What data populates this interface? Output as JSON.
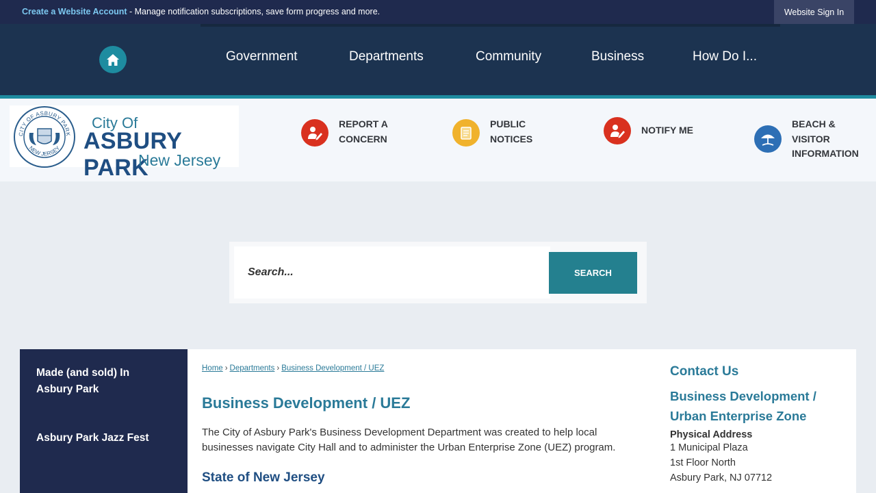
{
  "topbar": {
    "create_account": "Create a Website Account",
    "message": " - Manage notification subscriptions, save form progress and more.",
    "sign_in": "Website Sign In"
  },
  "nav": {
    "home_icon": "home-icon",
    "items": [
      "Government",
      "Departments",
      "Community",
      "Business",
      "How Do I..."
    ]
  },
  "logo": {
    "line1": "City Of",
    "line2": "ASBURY PARK",
    "line3": "New Jersey",
    "seal_text_top": "CITY OF ASBURY PARK",
    "seal_text_bottom": "NEW JERSEY"
  },
  "quick_links": [
    {
      "line1": "REPORT A",
      "line2": "CONCERN",
      "line3": "",
      "icon": "report-concern-icon",
      "color": "#d9311f"
    },
    {
      "line1": "PUBLIC",
      "line2": "NOTICES",
      "line3": "",
      "icon": "notice-icon",
      "color": "#f0b22c"
    },
    {
      "line1": "NOTIFY ME",
      "line2": "",
      "line3": "",
      "icon": "notify-icon",
      "color": "#d9311f"
    },
    {
      "line1": "BEACH &",
      "line2": "VISITOR",
      "line3": "INFORMATION",
      "icon": "beach-umbrella-icon",
      "color": "#2d6fb5"
    }
  ],
  "search": {
    "placeholder": "Search...",
    "button": "SEARCH"
  },
  "sidebar": {
    "items": [
      {
        "line1": "Made (and sold) In",
        "line2": "Asbury Park"
      },
      {
        "line1": "Asbury Park Jazz Fest",
        "line2": ""
      }
    ]
  },
  "breadcrumb": [
    "Home",
    "Departments",
    "Business Development / UEZ"
  ],
  "main": {
    "title": "Business Development / UEZ",
    "body": "The City of Asbury Park's Business Development Department was created to help local businesses navigate City Hall and to administer the Urban Enterprise Zone (UEZ) program.",
    "subheading": "State of New Jersey"
  },
  "contact": {
    "title": "Contact Us",
    "dept_line1": "Business Development /",
    "dept_line2": "Urban Enterprise Zone",
    "address_label": "Physical Address",
    "address": [
      "1 Municipal Plaza",
      "1st Floor North",
      "Asbury Park, NJ 07712"
    ]
  }
}
